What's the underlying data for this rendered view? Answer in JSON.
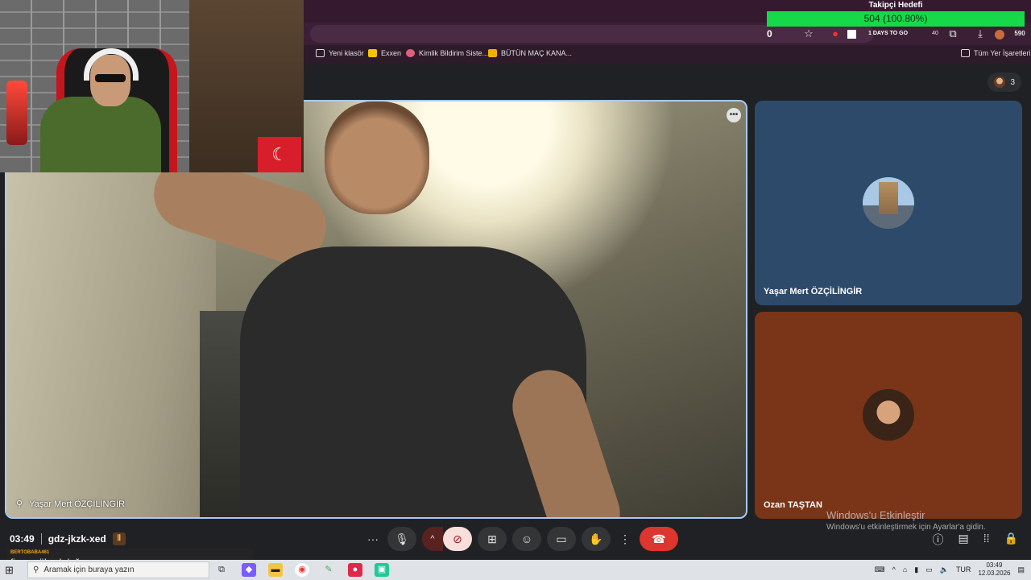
{
  "goal": {
    "title": "Takipçi Hedefi",
    "progress_text": "504 (100.80%)",
    "progress_fraction": 1.0,
    "counter": "0"
  },
  "toolbar": {
    "days_badge": "1 DAYS TO GO",
    "ext_count": "40",
    "profile_count": "590"
  },
  "bookmarks": {
    "items": [
      {
        "label": "Yeni klasör",
        "icon": "folder-icon"
      },
      {
        "label": "Exxen",
        "icon": "exxen-icon"
      },
      {
        "label": "Kimlik Bildirim Siste...",
        "icon": "link-icon"
      },
      {
        "label": "BÜTÜN MAÇ KANA...",
        "icon": "jp-icon"
      }
    ],
    "all_label": "Tüm Yer İşaretleri"
  },
  "meet": {
    "participant_count": "3",
    "main_tile_name": "Yaşar Mert ÖZÇİLİNGİR",
    "tiles": [
      {
        "name": "Yaşar Mert ÖZÇİLİNGİR"
      },
      {
        "name": "Ozan TAŞTAN"
      }
    ],
    "time": "03:49",
    "meeting_code": "gdz-jkzk-xed"
  },
  "watermark": {
    "title": "Windows'u Etkinleştir",
    "subtitle": "Windows'u etkinleştirmek için Ayarlar'a gidin."
  },
  "chat": {
    "user": "BERTOBABA461",
    "message": "figen yüksekdağ"
  },
  "taskbar": {
    "search_placeholder": "Aramak için buraya yazın",
    "lang": "TUR",
    "clock_time": "03:49",
    "clock_date": "12.03.2026"
  }
}
